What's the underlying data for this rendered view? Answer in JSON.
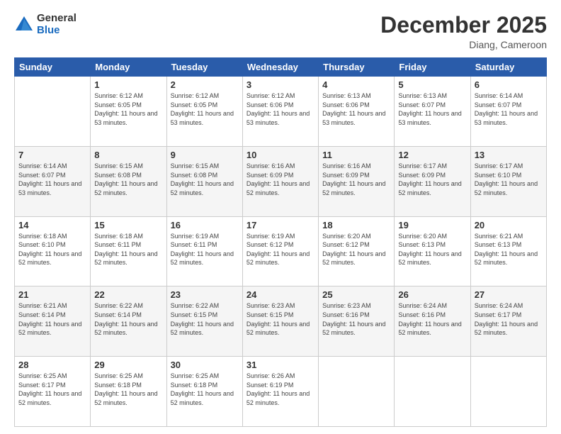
{
  "logo": {
    "general": "General",
    "blue": "Blue"
  },
  "title": "December 2025",
  "subtitle": "Diang, Cameroon",
  "days_of_week": [
    "Sunday",
    "Monday",
    "Tuesday",
    "Wednesday",
    "Thursday",
    "Friday",
    "Saturday"
  ],
  "weeks": [
    [
      {
        "day": "",
        "sunrise": "",
        "sunset": "",
        "daylight": ""
      },
      {
        "day": "1",
        "sunrise": "Sunrise: 6:12 AM",
        "sunset": "Sunset: 6:05 PM",
        "daylight": "Daylight: 11 hours and 53 minutes."
      },
      {
        "day": "2",
        "sunrise": "Sunrise: 6:12 AM",
        "sunset": "Sunset: 6:05 PM",
        "daylight": "Daylight: 11 hours and 53 minutes."
      },
      {
        "day": "3",
        "sunrise": "Sunrise: 6:12 AM",
        "sunset": "Sunset: 6:06 PM",
        "daylight": "Daylight: 11 hours and 53 minutes."
      },
      {
        "day": "4",
        "sunrise": "Sunrise: 6:13 AM",
        "sunset": "Sunset: 6:06 PM",
        "daylight": "Daylight: 11 hours and 53 minutes."
      },
      {
        "day": "5",
        "sunrise": "Sunrise: 6:13 AM",
        "sunset": "Sunset: 6:07 PM",
        "daylight": "Daylight: 11 hours and 53 minutes."
      },
      {
        "day": "6",
        "sunrise": "Sunrise: 6:14 AM",
        "sunset": "Sunset: 6:07 PM",
        "daylight": "Daylight: 11 hours and 53 minutes."
      }
    ],
    [
      {
        "day": "7",
        "sunrise": "Sunrise: 6:14 AM",
        "sunset": "Sunset: 6:07 PM",
        "daylight": "Daylight: 11 hours and 53 minutes."
      },
      {
        "day": "8",
        "sunrise": "Sunrise: 6:15 AM",
        "sunset": "Sunset: 6:08 PM",
        "daylight": "Daylight: 11 hours and 52 minutes."
      },
      {
        "day": "9",
        "sunrise": "Sunrise: 6:15 AM",
        "sunset": "Sunset: 6:08 PM",
        "daylight": "Daylight: 11 hours and 52 minutes."
      },
      {
        "day": "10",
        "sunrise": "Sunrise: 6:16 AM",
        "sunset": "Sunset: 6:09 PM",
        "daylight": "Daylight: 11 hours and 52 minutes."
      },
      {
        "day": "11",
        "sunrise": "Sunrise: 6:16 AM",
        "sunset": "Sunset: 6:09 PM",
        "daylight": "Daylight: 11 hours and 52 minutes."
      },
      {
        "day": "12",
        "sunrise": "Sunrise: 6:17 AM",
        "sunset": "Sunset: 6:09 PM",
        "daylight": "Daylight: 11 hours and 52 minutes."
      },
      {
        "day": "13",
        "sunrise": "Sunrise: 6:17 AM",
        "sunset": "Sunset: 6:10 PM",
        "daylight": "Daylight: 11 hours and 52 minutes."
      }
    ],
    [
      {
        "day": "14",
        "sunrise": "Sunrise: 6:18 AM",
        "sunset": "Sunset: 6:10 PM",
        "daylight": "Daylight: 11 hours and 52 minutes."
      },
      {
        "day": "15",
        "sunrise": "Sunrise: 6:18 AM",
        "sunset": "Sunset: 6:11 PM",
        "daylight": "Daylight: 11 hours and 52 minutes."
      },
      {
        "day": "16",
        "sunrise": "Sunrise: 6:19 AM",
        "sunset": "Sunset: 6:11 PM",
        "daylight": "Daylight: 11 hours and 52 minutes."
      },
      {
        "day": "17",
        "sunrise": "Sunrise: 6:19 AM",
        "sunset": "Sunset: 6:12 PM",
        "daylight": "Daylight: 11 hours and 52 minutes."
      },
      {
        "day": "18",
        "sunrise": "Sunrise: 6:20 AM",
        "sunset": "Sunset: 6:12 PM",
        "daylight": "Daylight: 11 hours and 52 minutes."
      },
      {
        "day": "19",
        "sunrise": "Sunrise: 6:20 AM",
        "sunset": "Sunset: 6:13 PM",
        "daylight": "Daylight: 11 hours and 52 minutes."
      },
      {
        "day": "20",
        "sunrise": "Sunrise: 6:21 AM",
        "sunset": "Sunset: 6:13 PM",
        "daylight": "Daylight: 11 hours and 52 minutes."
      }
    ],
    [
      {
        "day": "21",
        "sunrise": "Sunrise: 6:21 AM",
        "sunset": "Sunset: 6:14 PM",
        "daylight": "Daylight: 11 hours and 52 minutes."
      },
      {
        "day": "22",
        "sunrise": "Sunrise: 6:22 AM",
        "sunset": "Sunset: 6:14 PM",
        "daylight": "Daylight: 11 hours and 52 minutes."
      },
      {
        "day": "23",
        "sunrise": "Sunrise: 6:22 AM",
        "sunset": "Sunset: 6:15 PM",
        "daylight": "Daylight: 11 hours and 52 minutes."
      },
      {
        "day": "24",
        "sunrise": "Sunrise: 6:23 AM",
        "sunset": "Sunset: 6:15 PM",
        "daylight": "Daylight: 11 hours and 52 minutes."
      },
      {
        "day": "25",
        "sunrise": "Sunrise: 6:23 AM",
        "sunset": "Sunset: 6:16 PM",
        "daylight": "Daylight: 11 hours and 52 minutes."
      },
      {
        "day": "26",
        "sunrise": "Sunrise: 6:24 AM",
        "sunset": "Sunset: 6:16 PM",
        "daylight": "Daylight: 11 hours and 52 minutes."
      },
      {
        "day": "27",
        "sunrise": "Sunrise: 6:24 AM",
        "sunset": "Sunset: 6:17 PM",
        "daylight": "Daylight: 11 hours and 52 minutes."
      }
    ],
    [
      {
        "day": "28",
        "sunrise": "Sunrise: 6:25 AM",
        "sunset": "Sunset: 6:17 PM",
        "daylight": "Daylight: 11 hours and 52 minutes."
      },
      {
        "day": "29",
        "sunrise": "Sunrise: 6:25 AM",
        "sunset": "Sunset: 6:18 PM",
        "daylight": "Daylight: 11 hours and 52 minutes."
      },
      {
        "day": "30",
        "sunrise": "Sunrise: 6:25 AM",
        "sunset": "Sunset: 6:18 PM",
        "daylight": "Daylight: 11 hours and 52 minutes."
      },
      {
        "day": "31",
        "sunrise": "Sunrise: 6:26 AM",
        "sunset": "Sunset: 6:19 PM",
        "daylight": "Daylight: 11 hours and 52 minutes."
      },
      {
        "day": "",
        "sunrise": "",
        "sunset": "",
        "daylight": ""
      },
      {
        "day": "",
        "sunrise": "",
        "sunset": "",
        "daylight": ""
      },
      {
        "day": "",
        "sunrise": "",
        "sunset": "",
        "daylight": ""
      }
    ]
  ]
}
